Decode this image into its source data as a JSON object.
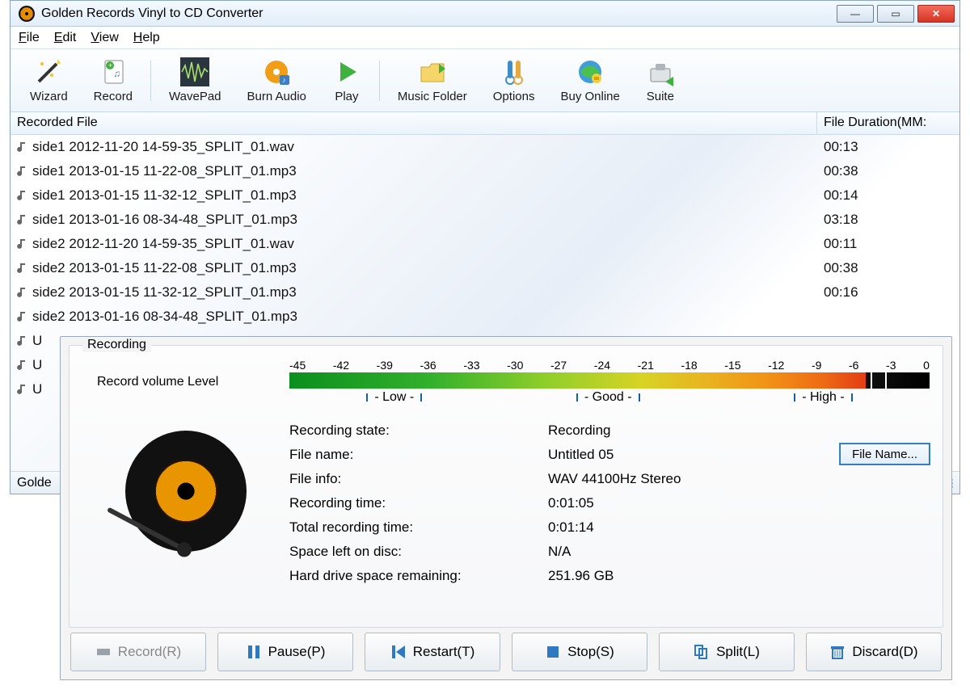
{
  "app": {
    "title": "Golden Records Vinyl to CD Converter"
  },
  "menu": {
    "file": "File",
    "edit": "Edit",
    "view": "View",
    "help": "Help"
  },
  "toolbar": {
    "wizard": "Wizard",
    "record": "Record",
    "wavepad": "WavePad",
    "burn": "Burn Audio",
    "play": "Play",
    "folder": "Music Folder",
    "options": "Options",
    "buy": "Buy Online",
    "suite": "Suite"
  },
  "list": {
    "col1": "Recorded File",
    "col2": "File Duration(MM:",
    "rows": [
      {
        "name": "side1 2012-11-20 14-59-35_SPLIT_01.wav",
        "dur": "00:13"
      },
      {
        "name": "side1 2013-01-15 11-22-08_SPLIT_01.mp3",
        "dur": "00:38"
      },
      {
        "name": "side1 2013-01-15 11-32-12_SPLIT_01.mp3",
        "dur": "00:14"
      },
      {
        "name": "side1 2013-01-16 08-34-48_SPLIT_01.mp3",
        "dur": "03:18"
      },
      {
        "name": "side2 2012-11-20 14-59-35_SPLIT_01.wav",
        "dur": "00:11"
      },
      {
        "name": "side2 2013-01-15 11-22-08_SPLIT_01.mp3",
        "dur": "00:38"
      },
      {
        "name": "side2 2013-01-15 11-32-12_SPLIT_01.mp3",
        "dur": "00:16"
      },
      {
        "name": "side2 2013-01-16 08-34-48_SPLIT_01.mp3",
        "dur": ""
      },
      {
        "name": "U",
        "dur": ""
      },
      {
        "name": "U",
        "dur": ""
      },
      {
        "name": "U",
        "dur": ""
      }
    ]
  },
  "status": {
    "text": "Golde"
  },
  "recording": {
    "groupTitle": "Recording",
    "volLabel": "Record volume Level",
    "scale": [
      "-45",
      "-42",
      "-39",
      "-36",
      "-33",
      "-30",
      "-27",
      "-24",
      "-21",
      "-18",
      "-15",
      "-12",
      "-9",
      "-6",
      "-3",
      "0"
    ],
    "quality": {
      "low": "- Low -",
      "good": "- Good -",
      "high": "- High -"
    },
    "labels": {
      "state": "Recording state:",
      "file": "File name:",
      "info": "File info:",
      "time": "Recording time:",
      "total": "Total recording time:",
      "disc": "Space left on disc:",
      "hdd": "Hard drive space remaining:"
    },
    "values": {
      "state": "Recording",
      "file": "Untitled 05",
      "info": "WAV 44100Hz Stereo",
      "time": "0:01:05",
      "total": "0:01:14",
      "disc": "N/A",
      "hdd": "251.96 GB"
    },
    "fileNameBtn": "File Name...",
    "buttons": {
      "record": "Record(R)",
      "pause": "Pause(P)",
      "restart": "Restart(T)",
      "stop": "Stop(S)",
      "split": "Split(L)",
      "discard": "Discard(D)"
    }
  }
}
